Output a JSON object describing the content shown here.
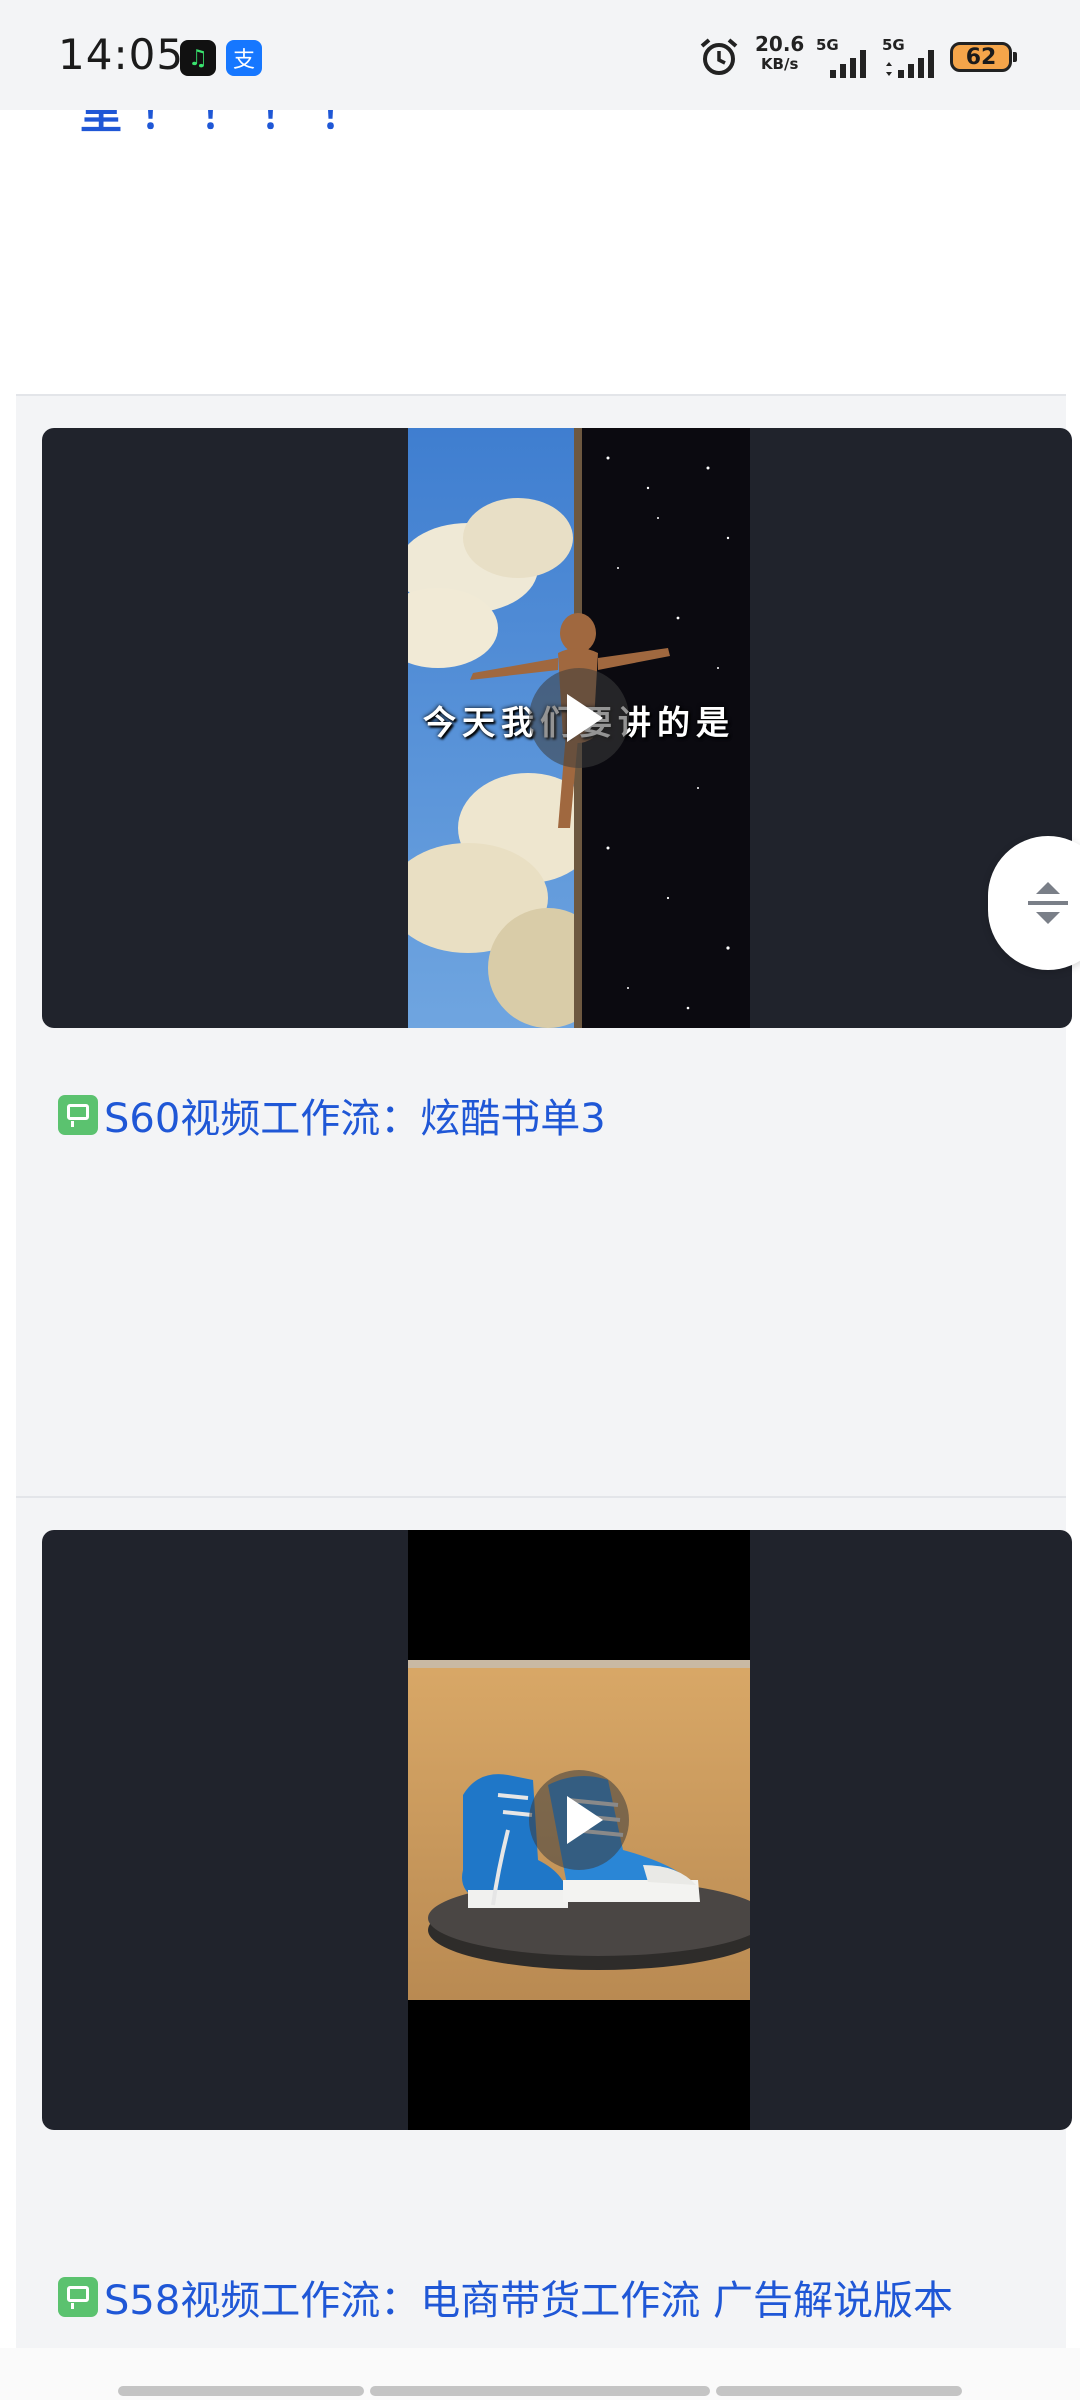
{
  "status_bar": {
    "time": "14:05",
    "apps": [
      "music-app-icon",
      "alipay-icon"
    ],
    "alipay_label": "支",
    "net_speed": "20.6",
    "net_speed_unit": "KB/s",
    "signal1_label": "5G",
    "signal2_label": "5G",
    "battery": "62",
    "battery_color": "#f5a54a"
  },
  "prev_item": {
    "text": "里！！！！"
  },
  "cards": [
    {
      "title": "S60视频工作流：炫酷书单3",
      "video_overlay_text": "今天我们要讲的是",
      "thumbnail": "sky-and-starfield-figure"
    },
    {
      "title": "S58视频工作流：电商带货工作流 广告解说版本",
      "thumbnail": "blue-sneakers-on-sand"
    }
  ],
  "colors": {
    "link_blue": "#1f57d6",
    "card_bg": "#f3f4f6",
    "video_bg": "#20232c",
    "icon_green": "#5bc26f"
  },
  "floating_button": {
    "icon": "expand-collapse-icon"
  }
}
